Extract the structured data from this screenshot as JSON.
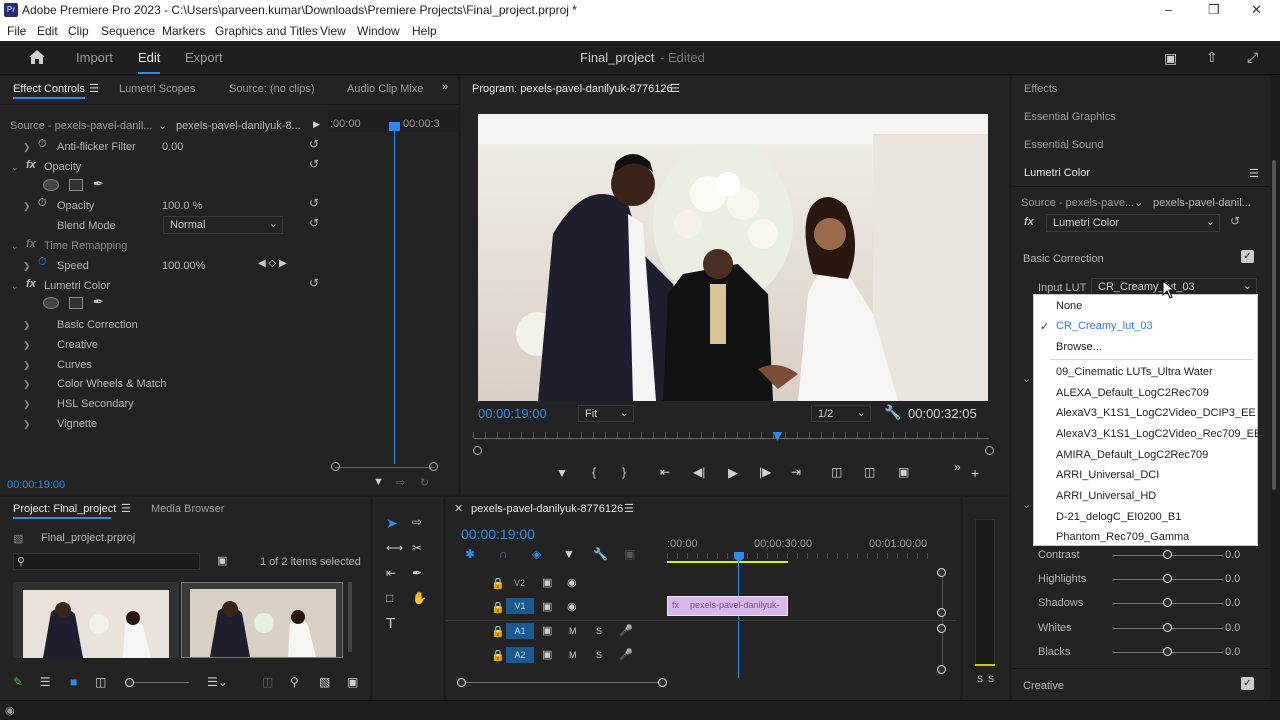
{
  "title_bar": {
    "text": "Adobe Premiere Pro 2023 - C:\\Users\\parveen.kumar\\Downloads\\Premiere Projects\\Final_project.prproj *",
    "logo": "Pr"
  },
  "menu": [
    "File",
    "Edit",
    "Clip",
    "Sequence",
    "Markers",
    "Graphics and Titles",
    "View",
    "Window",
    "Help"
  ],
  "header": {
    "import": "Import",
    "edit": "Edit",
    "export": "Export",
    "project_name": "Final_project",
    "edited": "- Edited"
  },
  "effect_controls": {
    "tabs": [
      "Effect Controls",
      "Lumetri Scopes",
      "Source: (no clips)",
      "Audio Clip Mixe"
    ],
    "source_label": "Source - pexels-pavel-danil...",
    "clip_label": "pexels-pavel-danilyuk-8...",
    "time_start": ":00:00",
    "time_end": "00:00:3",
    "rows": {
      "anti_flicker": "Anti-flicker Filter",
      "anti_flicker_val": "0.00",
      "opacity_fx": "Opacity",
      "opacity": "Opacity",
      "opacity_val": "100.0 %",
      "blend_mode": "Blend Mode",
      "blend_val": "Normal",
      "time_remap": "Time Remapping",
      "speed": "Speed",
      "speed_val": "100.00%",
      "lumetri": "Lumetri Color",
      "basic": "Basic Correction",
      "creative": "Creative",
      "curves": "Curves",
      "wheels": "Color Wheels & Match",
      "hsl": "HSL Secondary",
      "vignette": "Vignette"
    },
    "timecode": "00:00:19:00"
  },
  "program": {
    "title": "Program: pexels-pavel-danilyuk-8776126",
    "timecode": "00:00:19:00",
    "fit": "Fit",
    "resolution": "1/2",
    "duration": "00:00:32:05"
  },
  "right_panel": {
    "sections": [
      "Effects",
      "Essential Graphics",
      "Essential Sound",
      "Lumetri Color"
    ],
    "source": "Source - pexels-pave...",
    "clip": "pexels-pavel-danil...",
    "effect": "Lumetri Color",
    "basic_correction": "Basic Correction",
    "input_lut_label": "Input LUT",
    "input_lut_value": "CR_Creamy_lut_03",
    "sliders": [
      {
        "label": "Contrast",
        "value": "0.0"
      },
      {
        "label": "Highlights",
        "value": "0.0"
      },
      {
        "label": "Shadows",
        "value": "0.0"
      },
      {
        "label": "Whites",
        "value": "0.0"
      },
      {
        "label": "Blacks",
        "value": "0.0"
      }
    ],
    "creative": "Creative"
  },
  "lut_menu": {
    "top": [
      "None",
      "CR_Creamy_lut_03",
      "Browse..."
    ],
    "items": [
      "09_Cinematic LUTs_Ultra Water",
      "ALEXA_Default_LogC2Rec709",
      "AlexaV3_K1S1_LogC2Video_DCIP3_EE",
      "AlexaV3_K1S1_LogC2Video_Rec709_EE",
      "AMIRA_Default_LogC2Rec709",
      "ARRI_Universal_DCI",
      "ARRI_Universal_HD",
      "D-21_delogC_EI0200_B1",
      "Phantom_Rec709_Gamma"
    ]
  },
  "project": {
    "tabs": [
      "Project: Final_project",
      "Media Browser"
    ],
    "file": "Final_project.prproj",
    "items_selected": "1 of 2 items selected"
  },
  "timeline": {
    "title": "pexels-pavel-danilyuk-8776126",
    "timecode": "00:00:19:00",
    "ruler": [
      ":00:00",
      "00:00:30:00",
      "00:01:00:00"
    ],
    "tracks": [
      "V2",
      "V1",
      "A1",
      "A2"
    ],
    "track_letters": {
      "mute": "M",
      "solo": "S"
    },
    "clip_label": "pexels-pavel-danilyuk-",
    "meter_s": "S"
  }
}
